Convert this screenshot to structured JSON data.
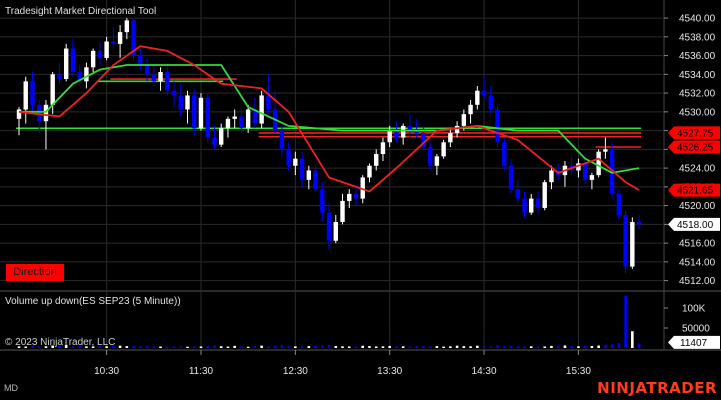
{
  "chart_title": "Tradesight Market Directional Tool",
  "direction_label": "Direction",
  "volume_title": "Volume up down(ES SEP23 (5 Minute))",
  "copyright": "© 2023 NinjaTrader, LLC",
  "brand": "NINJATRADER",
  "corner_label": "MD",
  "colors": {
    "up": "#ffffff",
    "down": "#0000ff",
    "fast_line": "#33dd33",
    "slow_line": "#ee2222",
    "tag_red": "#ff0000",
    "tag_white": "#ffffff"
  },
  "chart_data": [
    {
      "type": "candlestick",
      "ylim": [
        4511,
        4541.5
      ],
      "y_ticks": [
        "4540.00",
        "4538.00",
        "4536.00",
        "4534.00",
        "4532.00",
        "4530.00",
        "4528.00",
        "4526.00",
        "4524.00",
        "4522.00",
        "4520.00",
        "4518.00",
        "4516.00",
        "4514.00",
        "4512.00"
      ],
      "x_ticks": [
        "10:30",
        "11:30",
        "12:30",
        "13:30",
        "14:30",
        "15:30"
      ],
      "price_tags": [
        {
          "text": "4527.75",
          "value": 4527.75,
          "style": "red"
        },
        {
          "text": "4526.25",
          "value": 4526.25,
          "style": "red"
        },
        {
          "text": "4521.65",
          "value": 4521.65,
          "style": "red"
        },
        {
          "text": "4518.00",
          "value": 4518.0,
          "style": "white"
        }
      ],
      "candles": [
        [
          4529.25,
          4530.5,
          4527.5,
          4530.25
        ],
        [
          4530.25,
          4533.75,
          4528.75,
          4533.25
        ],
        [
          4533.25,
          4534.25,
          4529.75,
          4530.75
        ],
        [
          4530.75,
          4531.25,
          4527.75,
          4529.0
        ],
        [
          4529.0,
          4531.25,
          4526.0,
          4530.75
        ],
        [
          4530.75,
          4534.25,
          4529.75,
          4534.0
        ],
        [
          4534.0,
          4535.25,
          4533.0,
          4533.5
        ],
        [
          4533.5,
          4537.25,
          4533.25,
          4536.75
        ],
        [
          4536.75,
          4537.75,
          4533.75,
          4534.25
        ],
        [
          4534.25,
          4535.0,
          4532.75,
          4533.25
        ],
        [
          4533.25,
          4535.25,
          4532.5,
          4534.75
        ],
        [
          4534.75,
          4536.75,
          4534.25,
          4536.5
        ],
        [
          4536.5,
          4537.5,
          4535.0,
          4535.75
        ],
        [
          4535.75,
          4538.0,
          4535.5,
          4537.5
        ],
        [
          4537.5,
          4539.0,
          4536.75,
          4537.25
        ],
        [
          4537.25,
          4539.25,
          4535.75,
          4538.5
        ],
        [
          4538.5,
          4540.0,
          4537.75,
          4539.75
        ],
        [
          4539.75,
          4540.0,
          4535.5,
          4536.0
        ],
        [
          4536.0,
          4536.75,
          4534.5,
          4535.0
        ],
        [
          4535.0,
          4535.75,
          4533.25,
          4534.0
        ],
        [
          4534.0,
          4535.0,
          4532.75,
          4533.25
        ],
        [
          4533.25,
          4534.75,
          4532.25,
          4534.25
        ],
        [
          4534.25,
          4535.0,
          4531.75,
          4532.25
        ],
        [
          4532.25,
          4533.25,
          4530.5,
          4531.75
        ],
        [
          4531.75,
          4533.0,
          4529.5,
          4530.25
        ],
        [
          4530.25,
          4532.25,
          4528.75,
          4531.75
        ],
        [
          4531.75,
          4532.5,
          4527.5,
          4528.25
        ],
        [
          4528.25,
          4532.0,
          4528.0,
          4531.5
        ],
        [
          4531.5,
          4532.0,
          4526.75,
          4527.25
        ],
        [
          4527.25,
          4528.5,
          4526.0,
          4526.5
        ],
        [
          4526.5,
          4528.75,
          4526.25,
          4528.25
        ],
        [
          4528.25,
          4529.5,
          4527.25,
          4529.25
        ],
        [
          4529.25,
          4530.25,
          4528.25,
          4529.5
        ],
        [
          4529.5,
          4530.25,
          4527.75,
          4528.25
        ],
        [
          4528.25,
          4530.75,
          4527.75,
          4530.25
        ],
        [
          4530.25,
          4531.5,
          4528.25,
          4528.75
        ],
        [
          4528.75,
          4532.25,
          4528.25,
          4531.75
        ],
        [
          4531.75,
          4534.0,
          4529.75,
          4530.25
        ],
        [
          4530.25,
          4532.25,
          4527.75,
          4528.0
        ],
        [
          4528.0,
          4528.75,
          4525.25,
          4526.0
        ],
        [
          4526.0,
          4526.75,
          4523.75,
          4524.25
        ],
        [
          4524.25,
          4525.75,
          4523.25,
          4525.0
        ],
        [
          4525.0,
          4525.75,
          4522.0,
          4522.75
        ],
        [
          4522.75,
          4524.25,
          4521.75,
          4523.75
        ],
        [
          4523.75,
          4524.25,
          4521.5,
          4521.75
        ],
        [
          4521.75,
          4522.5,
          4518.25,
          4519.25
        ],
        [
          4519.25,
          4520.25,
          4515.25,
          4516.25
        ],
        [
          4516.25,
          4519.0,
          4516.0,
          4518.25
        ],
        [
          4518.25,
          4521.25,
          4518.0,
          4520.5
        ],
        [
          4520.5,
          4521.75,
          4519.75,
          4521.25
        ],
        [
          4521.25,
          4522.25,
          4520.0,
          4520.75
        ],
        [
          4520.75,
          4523.25,
          4520.25,
          4523.0
        ],
        [
          4523.0,
          4524.5,
          4522.5,
          4524.25
        ],
        [
          4524.25,
          4526.0,
          4523.75,
          4525.5
        ],
        [
          4525.5,
          4527.25,
          4524.75,
          4526.75
        ],
        [
          4526.75,
          4528.5,
          4526.25,
          4528.0
        ],
        [
          4528.0,
          4529.0,
          4526.75,
          4527.25
        ],
        [
          4527.25,
          4528.75,
          4526.5,
          4528.5
        ],
        [
          4528.5,
          4529.75,
          4527.25,
          4528.0
        ],
        [
          4528.0,
          4529.25,
          4527.25,
          4527.75
        ],
        [
          4527.75,
          4528.5,
          4526.0,
          4526.25
        ],
        [
          4526.25,
          4526.75,
          4523.75,
          4524.25
        ],
        [
          4524.25,
          4525.5,
          4523.25,
          4525.25
        ],
        [
          4525.25,
          4527.0,
          4525.0,
          4526.75
        ],
        [
          4526.75,
          4528.25,
          4526.25,
          4527.75
        ],
        [
          4527.75,
          4529.0,
          4527.25,
          4528.5
        ],
        [
          4528.5,
          4530.25,
          4528.0,
          4529.75
        ],
        [
          4529.75,
          4531.25,
          4528.75,
          4530.75
        ],
        [
          4530.75,
          4532.75,
          4530.25,
          4532.25
        ],
        [
          4532.25,
          4533.75,
          4531.25,
          4531.75
        ],
        [
          4531.75,
          4532.75,
          4529.75,
          4530.25
        ],
        [
          4530.25,
          4530.75,
          4526.25,
          4526.75
        ],
        [
          4526.75,
          4527.25,
          4523.75,
          4524.25
        ],
        [
          4524.25,
          4525.0,
          4521.25,
          4521.75
        ],
        [
          4521.75,
          4522.75,
          4520.25,
          4520.75
        ],
        [
          4520.75,
          4521.5,
          4518.75,
          4519.25
        ],
        [
          4519.25,
          4521.25,
          4519.0,
          4520.75
        ],
        [
          4520.75,
          4521.5,
          4519.25,
          4519.75
        ],
        [
          4519.75,
          4522.75,
          4519.5,
          4522.5
        ],
        [
          4522.5,
          4524.25,
          4521.75,
          4523.75
        ],
        [
          4523.75,
          4524.5,
          4522.75,
          4523.25
        ],
        [
          4523.25,
          4524.75,
          4522.0,
          4524.25
        ],
        [
          4524.25,
          4525.25,
          4523.25,
          4523.75
        ],
        [
          4523.75,
          4525.0,
          4523.0,
          4524.5
        ],
        [
          4524.5,
          4525.5,
          4522.25,
          4522.75
        ],
        [
          4522.75,
          4523.5,
          4521.75,
          4523.25
        ],
        [
          4523.25,
          4526.0,
          4523.0,
          4525.75
        ],
        [
          4525.75,
          4527.25,
          4525.0,
          4526.0
        ],
        [
          4526.0,
          4526.75,
          4520.75,
          4521.25
        ],
        [
          4521.25,
          4521.75,
          4518.5,
          4519.0
        ],
        [
          4519.0,
          4519.5,
          4512.75,
          4513.5
        ],
        [
          4513.5,
          4518.75,
          4513.25,
          4518.25
        ],
        [
          4518.25,
          4519.0,
          4517.5,
          4518.0
        ]
      ],
      "lines": [
        {
          "name": "fast",
          "points": [
            [
              0,
              4530.0
            ],
            [
              4,
              4530.0
            ],
            [
              8,
              4533.0
            ],
            [
              12,
              4534.5
            ],
            [
              16,
              4535.0
            ],
            [
              24,
              4535.0
            ],
            [
              30,
              4535.0
            ],
            [
              34,
              4530.5
            ],
            [
              40,
              4528.5
            ],
            [
              48,
              4528.0
            ],
            [
              56,
              4528.0
            ],
            [
              62,
              4528.0
            ],
            [
              68,
              4528.5
            ],
            [
              74,
              4528.0
            ],
            [
              80,
              4528.0
            ],
            [
              84,
              4525.0
            ],
            [
              88,
              4523.5
            ],
            [
              92,
              4524.0
            ]
          ]
        },
        {
          "name": "slow",
          "points": [
            [
              0,
              4530.0
            ],
            [
              6,
              4529.5
            ],
            [
              10,
              4532.0
            ],
            [
              14,
              4535.0
            ],
            [
              18,
              4537.0
            ],
            [
              22,
              4536.5
            ],
            [
              26,
              4535.0
            ],
            [
              30,
              4533.0
            ],
            [
              36,
              4532.5
            ],
            [
              40,
              4530.0
            ],
            [
              46,
              4523.0
            ],
            [
              52,
              4521.5
            ],
            [
              56,
              4524.0
            ],
            [
              62,
              4528.0
            ],
            [
              68,
              4528.5
            ],
            [
              74,
              4527.0
            ],
            [
              80,
              4523.5
            ],
            [
              86,
              4525.0
            ],
            [
              90,
              4522.5
            ],
            [
              92,
              4521.65
            ]
          ]
        }
      ],
      "levels": [
        {
          "y": 4528.25,
          "from": 0,
          "to": 92,
          "color": "green"
        },
        {
          "y": 4527.75,
          "from": 36,
          "to": 92,
          "color": "red"
        },
        {
          "y": 4527.35,
          "from": 36,
          "to": 92,
          "color": "red"
        },
        {
          "y": 4526.25,
          "from": 86,
          "to": 92,
          "color": "red"
        },
        {
          "y": 4533.5,
          "from": 14,
          "to": 32,
          "color": "red"
        },
        {
          "y": 4533.25,
          "from": 12,
          "to": 30,
          "color": "green"
        }
      ]
    },
    {
      "type": "bar",
      "name": "volume",
      "y_ticks": [
        "100K",
        "50000"
      ],
      "ylim": [
        0,
        140000
      ],
      "last_value_text": "11407",
      "values": [
        4200,
        3800,
        5100,
        3600,
        4400,
        6200,
        5000,
        7800,
        4600,
        5200,
        4100,
        3900,
        5600,
        4300,
        6800,
        5900,
        4700,
        5200,
        4800,
        5100,
        4200,
        3700,
        3500,
        4100,
        3900,
        3200,
        4500,
        3800,
        5200,
        6300,
        4400,
        3600,
        5400,
        3800,
        3100,
        4600,
        5900,
        4300,
        6100,
        7200,
        5800,
        4100,
        3900,
        4700,
        5300,
        6400,
        7600,
        5100,
        4200,
        3800,
        4100,
        5600,
        4800,
        3900,
        4200,
        5100,
        4600,
        4300,
        3900,
        5200,
        4400,
        4100,
        4800,
        3700,
        4200,
        5900,
        4600,
        4300,
        5700,
        4100,
        3600,
        6800,
        5300,
        4900,
        4600,
        3900,
        4300,
        4100,
        3800,
        5200,
        4700,
        6400,
        5100,
        4300,
        5800,
        4900,
        6200,
        8100,
        9300,
        12800,
        131000,
        42000,
        11407
      ],
      "up_flags": [
        1,
        1,
        0,
        0,
        1,
        1,
        0,
        1,
        0,
        0,
        1,
        1,
        0,
        1,
        0,
        1,
        1,
        0,
        0,
        0,
        0,
        1,
        0,
        0,
        0,
        1,
        0,
        1,
        0,
        0,
        1,
        1,
        1,
        0,
        1,
        0,
        1,
        0,
        0,
        0,
        0,
        1,
        0,
        1,
        0,
        0,
        0,
        1,
        1,
        1,
        0,
        1,
        1,
        1,
        1,
        1,
        0,
        1,
        0,
        0,
        0,
        0,
        1,
        1,
        1,
        1,
        1,
        1,
        1,
        0,
        0,
        0,
        0,
        0,
        0,
        0,
        1,
        0,
        1,
        1,
        0,
        1,
        0,
        1,
        0,
        1,
        1,
        0,
        0,
        0,
        0,
        1,
        0
      ]
    }
  ]
}
